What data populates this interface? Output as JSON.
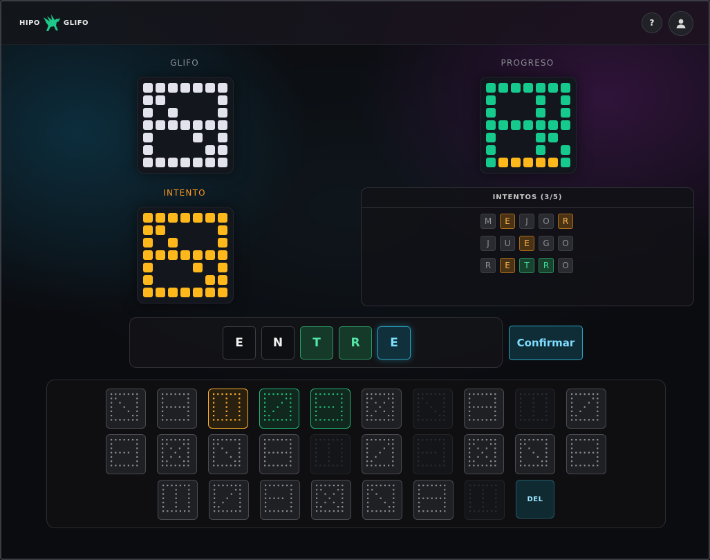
{
  "header": {
    "logo_left": "HIPO",
    "logo_right": "GLIFO",
    "help_label": "?",
    "icons": {
      "horse": "winged-horse-icon",
      "help": "help-icon",
      "user": "user-icon"
    }
  },
  "glifo": {
    "label": "GLIFO",
    "grid": [
      "WWWWWWW",
      "WW....W",
      "W.W...W",
      "WWWWWWW",
      "W...W.W",
      "W....WW",
      "WWWWWWW"
    ]
  },
  "progreso": {
    "label": "PROGRESO",
    "grid": [
      "GGGGGGG",
      "G...G.G",
      "G...G.G",
      "GGGGGGG",
      "G...GG.",
      "G...G.G",
      "GYYYYYG"
    ]
  },
  "intento": {
    "label": "INTENTO",
    "grid": [
      "YYYYYYY",
      "YY....Y",
      "Y.Y...Y",
      "YYYYYYY",
      "Y...Y.Y",
      "Y....YY",
      "YYYYYYY"
    ]
  },
  "attempts": {
    "title": "INTENTOS (3/5)",
    "rows": [
      [
        {
          "l": "M",
          "s": "miss"
        },
        {
          "l": "E",
          "s": "near"
        },
        {
          "l": "J",
          "s": "miss"
        },
        {
          "l": "O",
          "s": "miss"
        },
        {
          "l": "R",
          "s": "near"
        }
      ],
      [
        {
          "l": "J",
          "s": "miss"
        },
        {
          "l": "U",
          "s": "miss"
        },
        {
          "l": "E",
          "s": "near"
        },
        {
          "l": "G",
          "s": "miss"
        },
        {
          "l": "O",
          "s": "miss"
        }
      ],
      [
        {
          "l": "R",
          "s": "miss"
        },
        {
          "l": "E",
          "s": "near"
        },
        {
          "l": "T",
          "s": "ok"
        },
        {
          "l": "R",
          "s": "ok"
        },
        {
          "l": "O",
          "s": "miss"
        }
      ]
    ]
  },
  "current_word": [
    {
      "l": "E",
      "s": "plain"
    },
    {
      "l": "N",
      "s": "plain"
    },
    {
      "l": "T",
      "s": "ok"
    },
    {
      "l": "R",
      "s": "ok"
    },
    {
      "l": "E",
      "s": "cur"
    }
  ],
  "confirm_label": "Confirmar",
  "keyboard": {
    "rows": [
      [
        "normal",
        "normal",
        "near",
        "ok",
        "ok",
        "normal",
        "dim",
        "normal",
        "dim",
        "normal"
      ],
      [
        "normal",
        "normal",
        "normal",
        "normal",
        "dim",
        "normal",
        "dim",
        "normal",
        "normal",
        "normal"
      ],
      [
        "normal",
        "normal",
        "normal",
        "normal",
        "normal",
        "normal",
        "dim",
        "del"
      ]
    ],
    "del_label": "DEL"
  },
  "colors": {
    "white_cell": "#e3e3ee",
    "green_cell": "#16c98c",
    "yellow_cell": "#ffb81c",
    "accent_cyan": "#2aa6c7",
    "intento_label": "#ff9a1f"
  }
}
